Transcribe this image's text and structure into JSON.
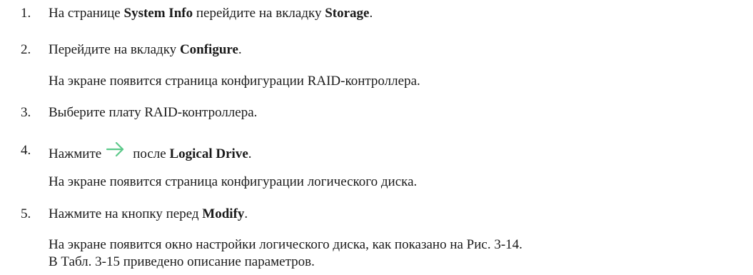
{
  "steps": [
    {
      "number": "1.",
      "prefix": "На странице ",
      "bold1": "System Info",
      "middle": " перейдите на вкладку ",
      "bold2": "Storage",
      "suffix": "."
    },
    {
      "number": "2.",
      "prefix": "Перейдите на вкладку ",
      "bold": "Configure",
      "suffix": ".",
      "note": "На экране появится страница конфигурации RAID-контроллера."
    },
    {
      "number": "3.",
      "text": "Выберите плату RAID-контроллера."
    },
    {
      "number": "4.",
      "prefix": "Нажмите",
      "icon": "arrow-right-icon",
      "middle": "после ",
      "bold": "Logical Drive",
      "suffix": ".",
      "note": "На экране появится страница конфигурации логического диска."
    },
    {
      "number": "5.",
      "prefix": "Нажмите на кнопку перед ",
      "bold": "Modify",
      "suffix": ".",
      "note_line1": "На экране появится окно настройки логического диска, как показано на Рис. 3-14.",
      "note_line2": "В Табл. 3-15 приведено описание параметров."
    }
  ],
  "colors": {
    "text": "#1a1a1a",
    "arrow": "#5cc98a"
  }
}
